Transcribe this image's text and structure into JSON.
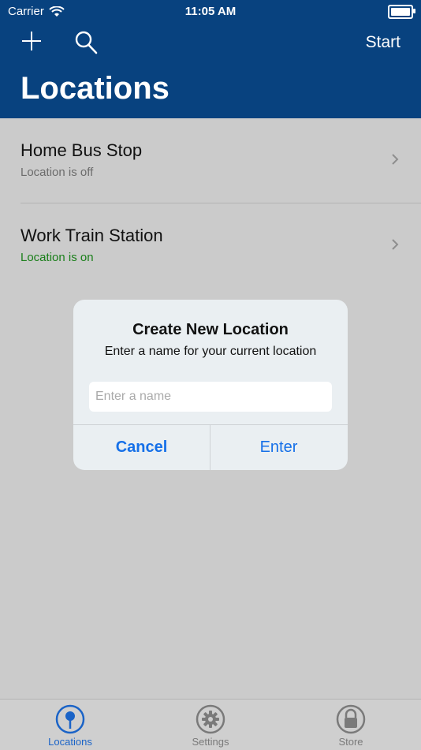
{
  "status_bar": {
    "carrier": "Carrier",
    "time": "11:05 AM"
  },
  "nav": {
    "add_icon": "plus-icon",
    "search_icon": "search-icon",
    "start_label": "Start"
  },
  "page": {
    "title": "Locations"
  },
  "locations": [
    {
      "name": "Home Bus Stop",
      "status": "Location is off",
      "status_color": "#6c6c6c"
    },
    {
      "name": "Work Train Station",
      "status": "Location is on",
      "status_color": "#1a7f1a"
    }
  ],
  "alert": {
    "title": "Create New Location",
    "message": "Enter a name for your current location",
    "input_placeholder": "Enter a name",
    "input_value": "",
    "cancel_label": "Cancel",
    "enter_label": "Enter"
  },
  "tabs": [
    {
      "label": "Locations",
      "icon": "map-pin-icon",
      "active": true
    },
    {
      "label": "Settings",
      "icon": "gear-icon",
      "active": false
    },
    {
      "label": "Store",
      "icon": "lock-icon",
      "active": false
    }
  ],
  "colors": {
    "header": "#08427f",
    "accent": "#1670e8",
    "on_status": "#1a7f1a"
  }
}
